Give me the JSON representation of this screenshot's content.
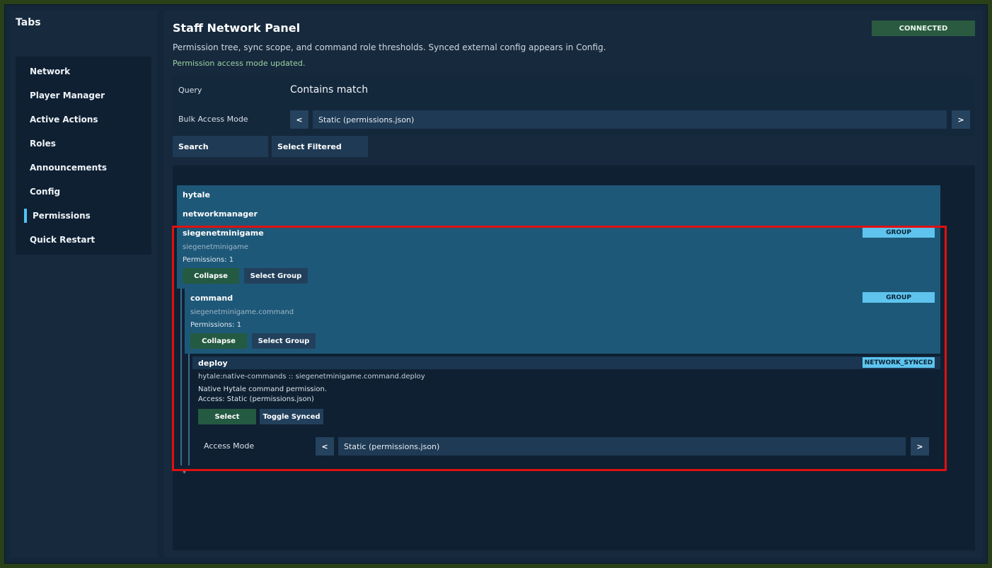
{
  "sidebar": {
    "title": "Tabs",
    "items": [
      {
        "label": "Network"
      },
      {
        "label": "Player Manager"
      },
      {
        "label": "Active Actions"
      },
      {
        "label": "Roles"
      },
      {
        "label": "Announcements"
      },
      {
        "label": "Config"
      },
      {
        "label": "Permissions",
        "active": true
      },
      {
        "label": "Quick Restart"
      }
    ]
  },
  "header": {
    "title": "Staff Network Panel",
    "description": "Permission tree, sync scope, and command role thresholds. Synced external config appears in Config.",
    "status_message": "Permission access mode updated.",
    "connection_badge": "CONNECTED"
  },
  "query": {
    "label": "Query",
    "value": "Contains match",
    "bulk_label": "Bulk Access Mode",
    "bulk_value": "Static (permissions.json)",
    "prev": "<",
    "next": ">",
    "search_button": "Search",
    "select_filtered_button": "Select Filtered"
  },
  "tree": {
    "nodes": [
      {
        "name": "hytale"
      },
      {
        "name": "networkmanager"
      }
    ],
    "group1": {
      "name": "siegenetminigame",
      "path": "siegenetminigame",
      "permissions": "Permissions: 1",
      "badge": "GROUP",
      "collapse": "Collapse",
      "select_group": "Select Group"
    },
    "group2": {
      "name": "command",
      "path": "siegenetminigame.command",
      "permissions": "Permissions: 1",
      "badge": "GROUP",
      "collapse": "Collapse",
      "select_group": "Select Group"
    },
    "leaf": {
      "name": "deploy",
      "path": "hytale:native-commands :: siegenetminigame.command.deploy",
      "description": "Native Hytale command permission.",
      "access": "Access: Static (permissions.json)",
      "badge": "NETWORK_SYNCED",
      "select": "Select",
      "toggle_synced": "Toggle Synced",
      "access_mode_label": "Access Mode",
      "access_mode_value": "Static (permissions.json)",
      "prev": "<",
      "next": ">"
    },
    "trailing": "*"
  },
  "colors": {
    "accent": "#4fc3f7",
    "connected": "#2a5a3f",
    "badge": "#5ec4ee",
    "highlight": "#e01010"
  }
}
